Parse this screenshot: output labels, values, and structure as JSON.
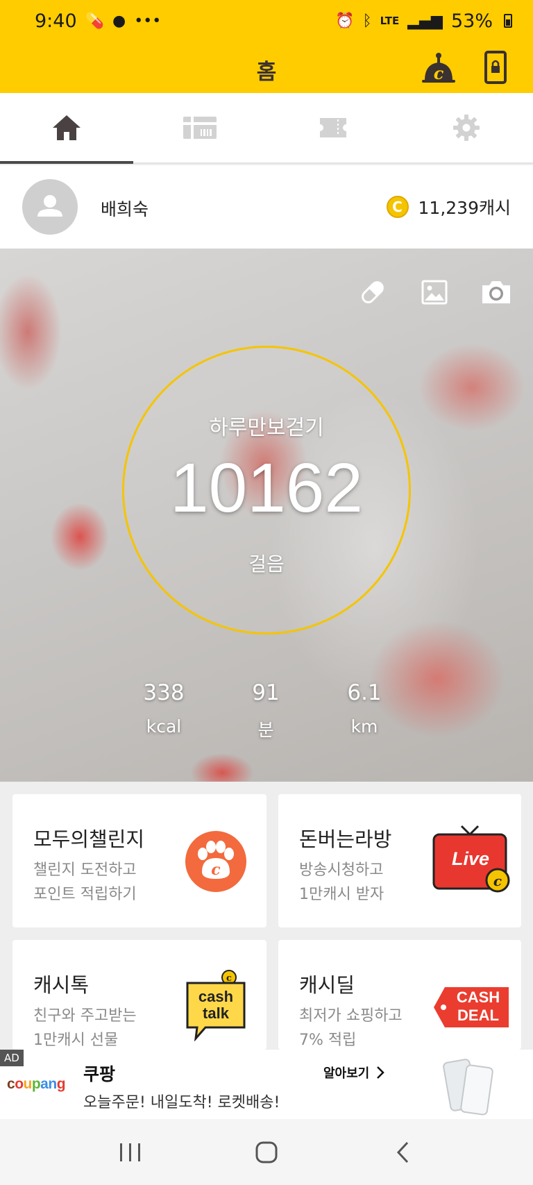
{
  "status_bar": {
    "time": "9:40",
    "network": "LTE",
    "battery": "53%"
  },
  "app_bar": {
    "title": "홈"
  },
  "tabs": [
    {
      "name": "home",
      "active": true
    },
    {
      "name": "gift-shop",
      "active": false
    },
    {
      "name": "coupon",
      "active": false
    },
    {
      "name": "settings",
      "active": false
    }
  ],
  "profile": {
    "name": "배희숙",
    "cash": "11,239캐시",
    "coin_symbol": "C"
  },
  "walk": {
    "title": "하루만보걷기",
    "steps": "10162",
    "steps_unit": "걸음",
    "stats": [
      {
        "value": "338",
        "label": "kcal"
      },
      {
        "value": "91",
        "label": "분"
      },
      {
        "value": "6.1",
        "label": "km"
      }
    ]
  },
  "cards": [
    {
      "title": "모두의챌린지",
      "desc1": "챌린지 도전하고",
      "desc2": "포인트 적립하기"
    },
    {
      "title": "돈버는라방",
      "desc1": "방송시청하고",
      "desc2": "1만캐시 받자",
      "icon_text": "Live"
    },
    {
      "title": "캐시톡",
      "desc1": "친구와 주고받는",
      "desc2": "1만캐시 선물",
      "icon_text1": "cash",
      "icon_text2": "talk"
    },
    {
      "title": "캐시딜",
      "desc1": "최저가 쇼핑하고",
      "desc2": "7% 적립",
      "icon_text1": "CASH",
      "icon_text2": "DEAL"
    }
  ],
  "ad": {
    "tag": "AD",
    "logo": "coupang",
    "title": "쿠팡",
    "desc": "오늘주문! 내일도착! 로켓배송!",
    "link": "알아보기"
  },
  "colors": {
    "brand_yellow": "#ffcc00",
    "ring": "#f5c400",
    "challenge_orange": "#f26a3d",
    "live_red": "#e8372f",
    "deal_red": "#ea3d2f"
  }
}
